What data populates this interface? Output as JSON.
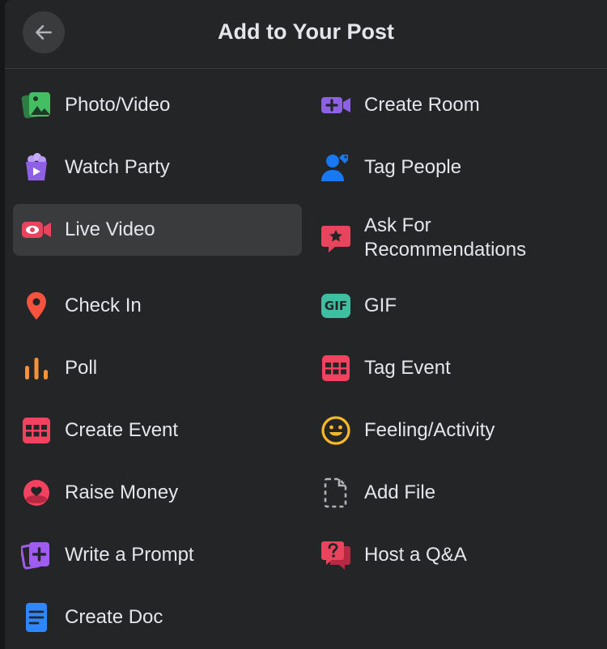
{
  "header": {
    "title": "Add to Your Post",
    "back_icon": "arrow-left-icon"
  },
  "items_left": [
    {
      "label": "Photo/Video",
      "icon": "photo-video-icon",
      "color": "#45bd62"
    },
    {
      "label": "Watch Party",
      "icon": "watch-party-icon",
      "color": "#8d60e6"
    },
    {
      "label": "Live Video",
      "icon": "live-video-icon",
      "color": "#e9445d",
      "selected": true
    },
    {
      "label": "Check In",
      "icon": "location-pin-icon",
      "color": "#f5533d"
    },
    {
      "label": "Poll",
      "icon": "poll-icon",
      "color": "#f7923b"
    },
    {
      "label": "Create Event",
      "icon": "calendar-icon",
      "color": "#f3425f"
    },
    {
      "label": "Raise Money",
      "icon": "raise-money-icon",
      "color": "#f3425f"
    },
    {
      "label": "Write a Prompt",
      "icon": "write-prompt-icon",
      "color": "#a05cf0"
    },
    {
      "label": "Create Doc",
      "icon": "document-icon",
      "color": "#2d88ff"
    }
  ],
  "items_right": [
    {
      "label": "Create Room",
      "icon": "create-room-icon",
      "color": "#8d60e6"
    },
    {
      "label": "Tag People",
      "icon": "tag-people-icon",
      "color": "#1877f2"
    },
    {
      "label": "Ask For Recommendations",
      "icon": "recommendation-icon",
      "color": "#e9445d"
    },
    {
      "label": "GIF",
      "icon": "gif-icon",
      "color": "#3fbfa1"
    },
    {
      "label": "Tag Event",
      "icon": "tag-event-icon",
      "color": "#f3425f"
    },
    {
      "label": "Feeling/Activity",
      "icon": "smiley-icon",
      "color": "#f7b928"
    },
    {
      "label": "Add File",
      "icon": "file-icon",
      "color": "#b0b3b8"
    },
    {
      "label": "Host a Q&A",
      "icon": "qa-icon",
      "color": "#e9445d"
    }
  ],
  "gif_icon_text": "GIF"
}
